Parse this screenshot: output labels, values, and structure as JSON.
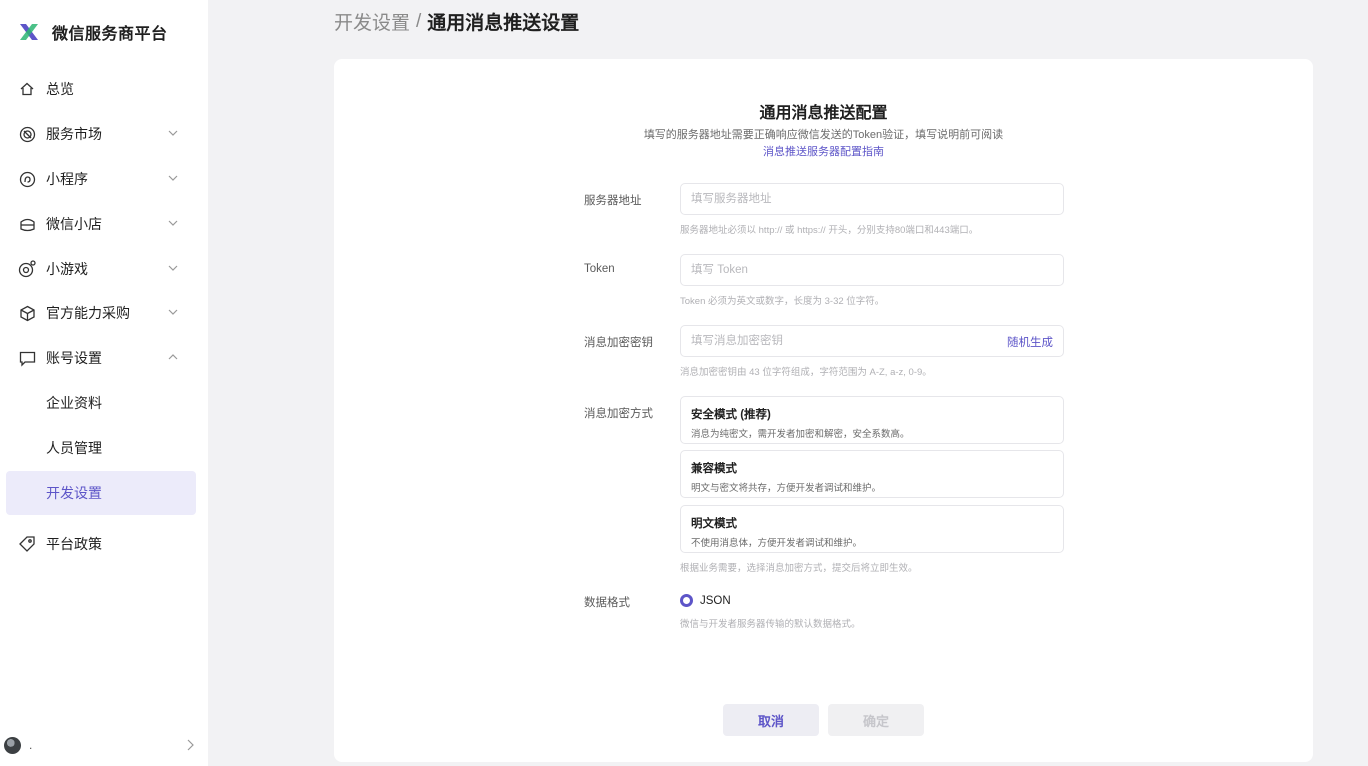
{
  "app": {
    "title": "微信服务商平台"
  },
  "sidebar": {
    "items": [
      {
        "label": "总览",
        "icon": "home-icon"
      },
      {
        "label": "服务市场",
        "icon": "market-icon"
      },
      {
        "label": "小程序",
        "icon": "miniprogram-icon"
      },
      {
        "label": "微信小店",
        "icon": "shop-icon"
      },
      {
        "label": "小游戏",
        "icon": "game-icon"
      },
      {
        "label": "官方能力采购",
        "icon": "box-icon"
      },
      {
        "label": "账号设置",
        "icon": "chat-icon"
      },
      {
        "label": "企业资料"
      },
      {
        "label": "人员管理"
      },
      {
        "label": "开发设置"
      },
      {
        "label": "平台政策",
        "icon": "tag-icon"
      }
    ],
    "active_item": "开发设置",
    "user": {
      "name": "."
    }
  },
  "breadcrumb": {
    "parent": "开发设置",
    "separator": "/",
    "current": "通用消息推送设置"
  },
  "form": {
    "title": "通用消息推送配置",
    "description": "填写的服务器地址需要正确响应微信发送的Token验证，填写说明前可阅读",
    "guide_link": "消息推送服务器配置指南",
    "server": {
      "label": "服务器地址",
      "placeholder": "填写服务器地址",
      "value": "",
      "help": "服务器地址必须以 http:// 或 https:// 开头，分别支持80端口和443端口。"
    },
    "token": {
      "label": "Token",
      "placeholder": "填写 Token",
      "value": "",
      "help": "Token 必须为英文或数字，长度为 3-32 位字符。"
    },
    "aes_key": {
      "label": "消息加密密钥",
      "placeholder": "填写消息加密密钥",
      "value": "",
      "generate_label": "随机生成",
      "help": "消息加密密钥由 43 位字符组成，字符范围为 A-Z, a-z, 0-9。"
    },
    "encrypt_mode": {
      "label": "消息加密方式",
      "options": [
        {
          "title": "安全模式 (推荐)",
          "desc": "消息为纯密文，需开发者加密和解密，安全系数高。"
        },
        {
          "title": "兼容模式",
          "desc": "明文与密文将共存，方便开发者调试和维护。"
        },
        {
          "title": "明文模式",
          "desc": "不使用消息体，方便开发者调试和维护。"
        }
      ],
      "help": "根据业务需要，选择消息加密方式，提交后将立即生效。"
    },
    "data_format": {
      "label": "数据格式",
      "option": "JSON",
      "help": "微信与开发者服务器传输的默认数据格式。"
    },
    "buttons": {
      "cancel": "取消",
      "confirm": "确定"
    }
  },
  "colors": {
    "accent": "#5d55c8",
    "active_bg": "#ecebfa",
    "page_bg": "#f2f2f4"
  }
}
